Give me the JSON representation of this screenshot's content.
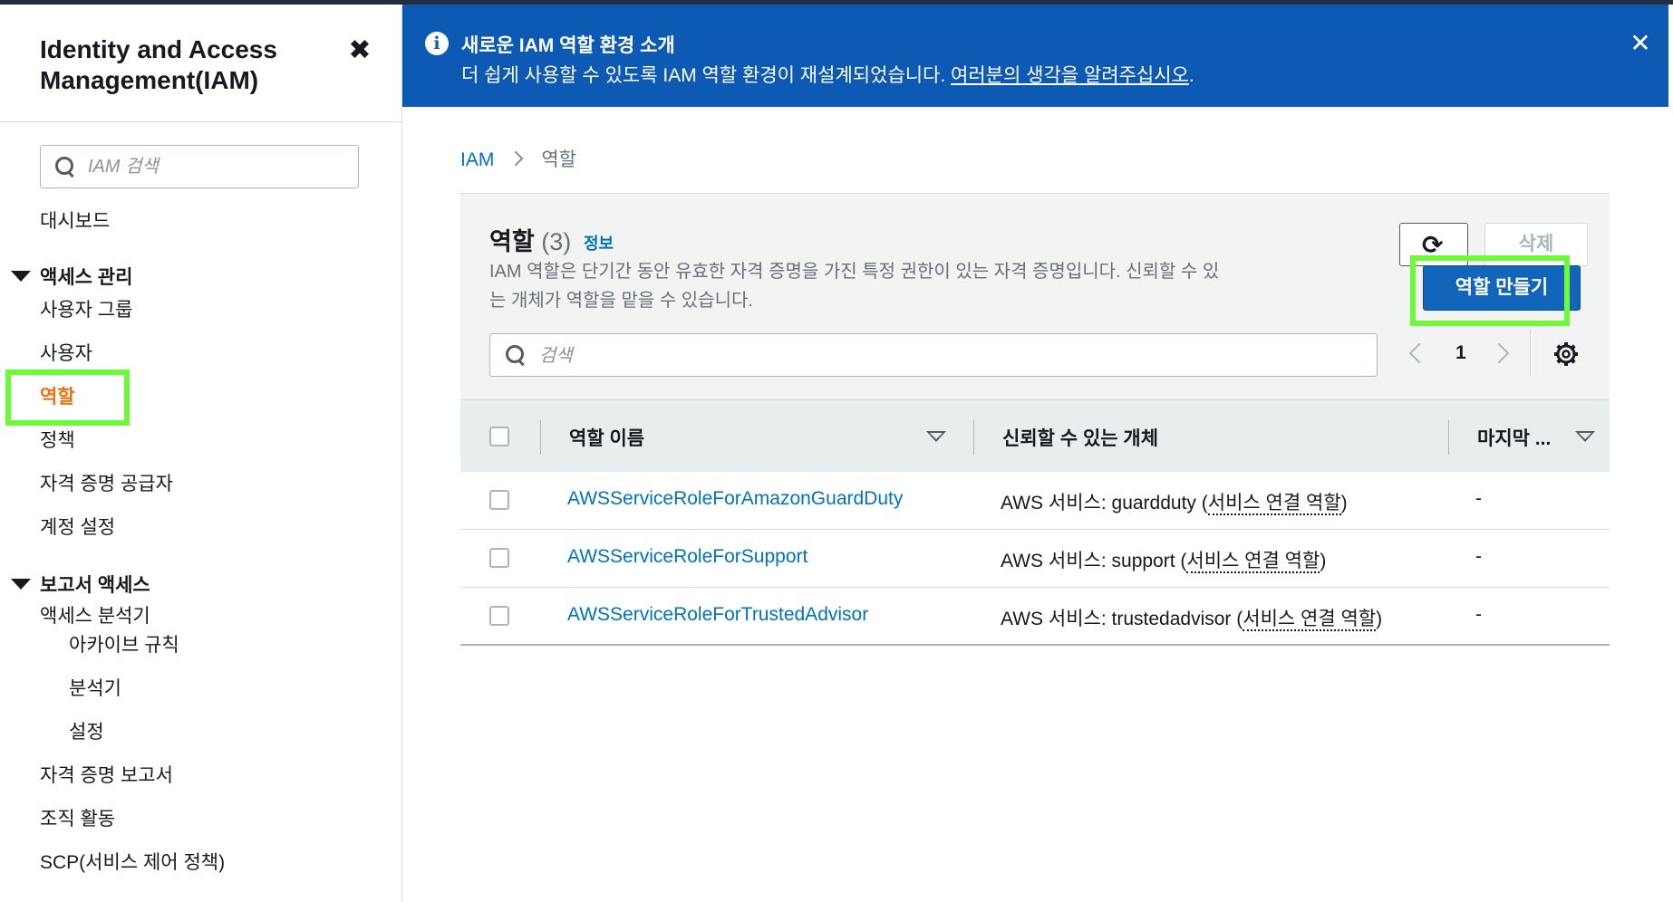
{
  "sidebar": {
    "title": "Identity and Access Management(IAM)",
    "close_icon": "close-icon",
    "search_placeholder": "IAM 검색",
    "dashboard": "대시보드",
    "section_access": "액세스 관리",
    "user_groups": "사용자 그룹",
    "users": "사용자",
    "roles": "역할",
    "policies": "정책",
    "identity_providers": "자격 증명 공급자",
    "account_settings": "계정 설정",
    "section_reports": "보고서 액세스",
    "access_analyzer": "액세스 분석기",
    "archive_rules": "아카이브 규칙",
    "analyzers": "분석기",
    "settings": "설정",
    "credential_report": "자격 증명 보고서",
    "org_activity": "조직 활동",
    "scp": "SCP(서비스 제어 정책)"
  },
  "banner": {
    "title": "새로운 IAM 역할 환경 소개",
    "text": "더 쉽게 사용할 수 있도록 IAM 역할 환경이 재설계되었습니다. ",
    "link": "여러분의 생각을 알려주십시오",
    "trail": ".",
    "color": "#0d5ab4"
  },
  "breadcrumb": {
    "root": "IAM",
    "current": "역할"
  },
  "panel": {
    "title": "역할",
    "count": "(3)",
    "info": "정보",
    "description": "IAM 역할은 단기간 동안 유효한 자격 증명을 가진 특정 권한이 있는 자격 증명입니다. 신뢰할 수 있는 개체가 역할을 맡을 수 있습니다.",
    "delete_label": "삭제",
    "create_label": "역할 만들기",
    "search_placeholder": "검색",
    "page": "1"
  },
  "table": {
    "headers": {
      "name": "역할 이름",
      "trusted": "신뢰할 수 있는 개체",
      "last": "마지막 ..."
    },
    "rows": [
      {
        "name": "AWSServiceRoleForAmazonGuardDuty",
        "trusted_prefix": "AWS 서비스: guardduty (",
        "trusted_link": "서비스 연결 역할",
        "trusted_suffix": ")",
        "last": "-"
      },
      {
        "name": "AWSServiceRoleForSupport",
        "trusted_prefix": "AWS 서비스: support (",
        "trusted_link": "서비스 연결 역할",
        "trusted_suffix": ")",
        "last": "-"
      },
      {
        "name": "AWSServiceRoleForTrustedAdvisor",
        "trusted_prefix": "AWS 서비스: trustedadvisor (",
        "trusted_link": "서비스 연결 역할",
        "trusted_suffix": ")",
        "last": "-"
      }
    ]
  },
  "colors": {
    "accent_orange": "#ec7211",
    "link_blue": "#0073bb",
    "primary_button": "#1166bb",
    "highlight_green": "#6dfa3b"
  }
}
